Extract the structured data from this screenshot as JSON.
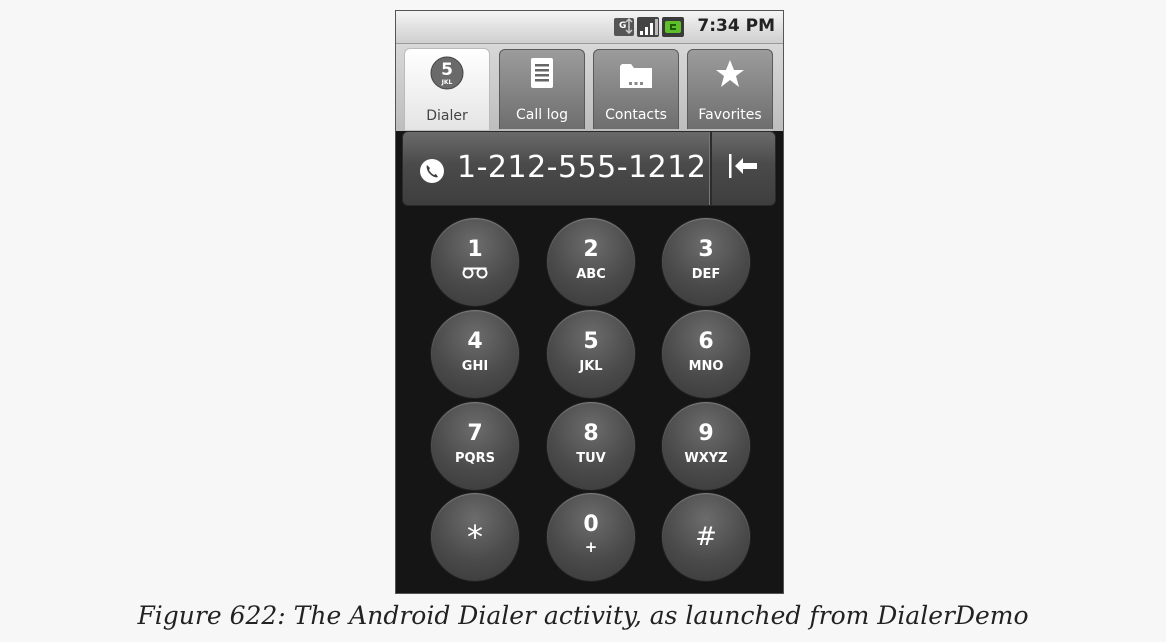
{
  "status_bar": {
    "time": "7:34 PM",
    "icons": [
      "data-sync-icon",
      "signal-bars-icon",
      "battery-charging-icon"
    ]
  },
  "tabs": [
    {
      "label": "Dialer",
      "icon": "dialpad-5-icon",
      "icon_digit": "5",
      "icon_letters": "JKL",
      "active": true
    },
    {
      "label": "Call log",
      "icon": "list-icon",
      "active": false
    },
    {
      "label": "Contacts",
      "icon": "folder-icon",
      "active": false
    },
    {
      "label": "Favorites",
      "icon": "star-icon",
      "active": false
    }
  ],
  "number_field": {
    "value": "1-212-555-1212",
    "icon": "phone-handset-icon",
    "backspace_icon": "backspace-arrow-icon"
  },
  "keypad": [
    {
      "digit": "1",
      "letters": "ơo",
      "voicemail": true
    },
    {
      "digit": "2",
      "letters": "ABC"
    },
    {
      "digit": "3",
      "letters": "DEF"
    },
    {
      "digit": "4",
      "letters": "GHI"
    },
    {
      "digit": "5",
      "letters": "JKL"
    },
    {
      "digit": "6",
      "letters": "MNO"
    },
    {
      "digit": "7",
      "letters": "PQRS"
    },
    {
      "digit": "8",
      "letters": "TUV"
    },
    {
      "digit": "9",
      "letters": "WXYZ"
    },
    {
      "symbol": "*"
    },
    {
      "digit": "0",
      "letters": "+"
    },
    {
      "symbol": "#"
    }
  ],
  "caption": "Figure 622: The Android Dialer activity, as launched from DialerDemo",
  "colors": {
    "phone_bg": "#151515",
    "key_face": "#4a4a4a",
    "status_text": "#222222"
  }
}
